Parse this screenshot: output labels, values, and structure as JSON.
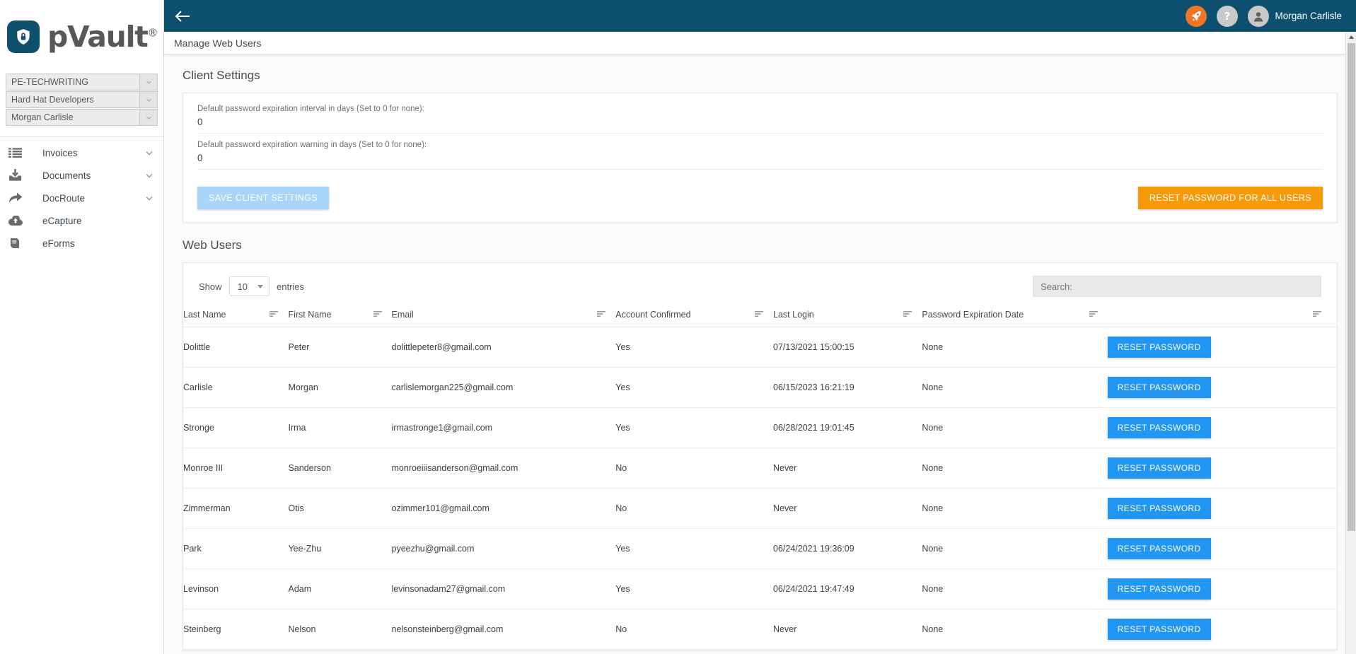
{
  "brand": {
    "name": "pVault",
    "trademark": "®",
    "lock_icon": "lock-shield-icon",
    "primary_color": "#0d4f6f"
  },
  "sidebar": {
    "selectors": [
      {
        "label": "PE-TECHWRITING",
        "icon": "chevron-down-icon"
      },
      {
        "label": "Hard Hat Developers",
        "icon": "chevron-down-icon"
      },
      {
        "label": "Morgan Carlisle",
        "icon": "chevron-down-icon"
      }
    ],
    "nav": [
      {
        "label": "Invoices",
        "icon": "list-icon",
        "caret": "chevron-down-icon",
        "has_caret": true
      },
      {
        "label": "Documents",
        "icon": "download-icon",
        "caret": "chevron-down-icon",
        "has_caret": true
      },
      {
        "label": "DocRoute",
        "icon": "share-arrow-icon",
        "caret": "chevron-down-icon",
        "has_caret": true
      },
      {
        "label": "eCapture",
        "icon": "cloud-upload-icon",
        "caret": "",
        "has_caret": false
      },
      {
        "label": "eForms",
        "icon": "book-icon",
        "caret": "",
        "has_caret": false
      }
    ]
  },
  "topbar": {
    "back_icon": "back-arrow-icon",
    "rocket_icon": "rocket-icon",
    "help_icon": "question-mark-icon",
    "avatar_icon": "user-avatar-icon",
    "user_name": "Morgan Carlisle",
    "rocket_color": "#ef7622",
    "help_color": "#c9c9c9"
  },
  "breadcrumb": {
    "text": "Manage Web Users"
  },
  "client_settings": {
    "title": "Client Settings",
    "fields": [
      {
        "label": "Default password expiration interval in days (Set to 0 for none):",
        "value": "0"
      },
      {
        "label": "Default password expiration warning in days (Set to 0 for none):",
        "value": "0"
      }
    ],
    "save_button": "SAVE CLIENT SETTINGS",
    "reset_all_button": "RESET PASSWORD FOR ALL USERS",
    "save_button_color": "#a8d5f8",
    "reset_all_button_color": "#f79a0a"
  },
  "web_users": {
    "title": "Web Users",
    "show_label": "Show",
    "entries_label": "entries",
    "page_size": "10",
    "search_placeholder": "Search:",
    "search_value": "",
    "columns": [
      "Last Name",
      "First Name",
      "Email",
      "Account Confirmed",
      "Last Login",
      "Password Expiration Date",
      ""
    ],
    "row_button_label": "RESET PASSWORD",
    "row_button_color": "#2196f3",
    "rows": [
      {
        "last_name": "Dolittle",
        "first_name": "Peter",
        "email": "dolittlepeter8@gmail.com",
        "confirmed": "Yes",
        "last_login": "07/13/2021 15:00:15",
        "pw_expiration": "None"
      },
      {
        "last_name": "Carlisle",
        "first_name": "Morgan",
        "email": "carlislemorgan225@gmail.com",
        "confirmed": "Yes",
        "last_login": "06/15/2023 16:21:19",
        "pw_expiration": "None"
      },
      {
        "last_name": "Stronge",
        "first_name": "Irma",
        "email": "irmastronge1@gmail.com",
        "confirmed": "Yes",
        "last_login": "06/28/2021 19:01:45",
        "pw_expiration": "None"
      },
      {
        "last_name": "Monroe III",
        "first_name": "Sanderson",
        "email": "monroeiiisanderson@gmail.com",
        "confirmed": "No",
        "last_login": "Never",
        "pw_expiration": "None"
      },
      {
        "last_name": "Zimmerman",
        "first_name": "Otis",
        "email": "ozimmer101@gmail.com",
        "confirmed": "No",
        "last_login": "Never",
        "pw_expiration": "None"
      },
      {
        "last_name": "Park",
        "first_name": "Yee-Zhu",
        "email": "pyeezhu@gmail.com",
        "confirmed": "Yes",
        "last_login": "06/24/2021 19:36:09",
        "pw_expiration": "None"
      },
      {
        "last_name": "Levinson",
        "first_name": "Adam",
        "email": "levinsonadam27@gmail.com",
        "confirmed": "Yes",
        "last_login": "06/24/2021 19:47:49",
        "pw_expiration": "None"
      },
      {
        "last_name": "Steinberg",
        "first_name": "Nelson",
        "email": "nelsonsteinberg@gmail.com",
        "confirmed": "No",
        "last_login": "Never",
        "pw_expiration": "None"
      }
    ]
  }
}
